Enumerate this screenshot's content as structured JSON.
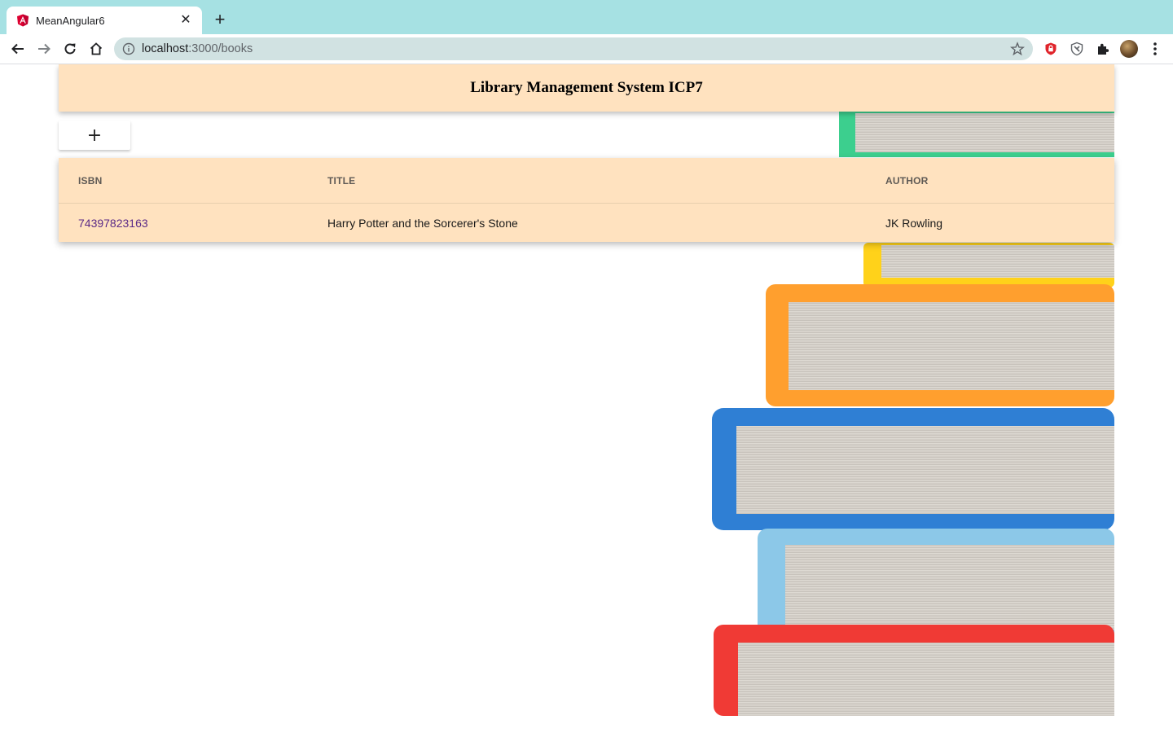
{
  "browser": {
    "tab_title": "MeanAngular6",
    "url_host": "localhost",
    "url_path": ":3000/books"
  },
  "page": {
    "header_title": "Library Management System ICP7",
    "add_button_label": "+",
    "table": {
      "columns": [
        "ISBN",
        "TITLE",
        "AUTHOR"
      ],
      "rows": [
        {
          "isbn": "74397823163",
          "title": "Harry Potter and the Sorcerer's Stone",
          "author": "JK Rowling"
        }
      ]
    }
  },
  "colors": {
    "tabstrip": "#a6e1e3",
    "omnibox": "#d1e2e2",
    "card_background": "#ffe2bf",
    "link": "#5b2a86",
    "angular_red": "#dd0031"
  }
}
